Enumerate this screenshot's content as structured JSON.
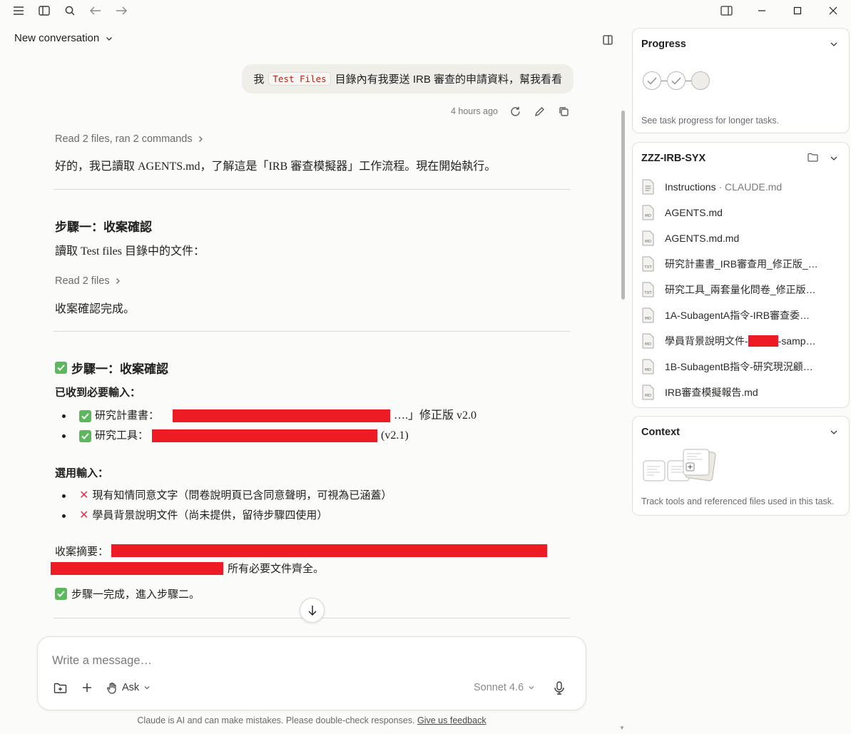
{
  "conversation": {
    "title": "New conversation"
  },
  "user_message": {
    "prefix": "我",
    "code": "Test Files",
    "suffix": "目錄內有我要送 IRB 審查的申請資料，幫我看看",
    "timestamp": "4 hours ago"
  },
  "assistant": {
    "tool1": "Read 2 files, ran 2 commands",
    "intro": "好的，我已讀取 AGENTS.md，了解這是「IRB 審查模擬器」工作流程。現在開始執行。",
    "step1_heading": "步驟一：收案確認",
    "step1_text": "讀取 Test files 目錄中的文件：",
    "tool2": "Read 2 files",
    "step1_done": "收案確認完成。",
    "step1b_heading": "步驟一：收案確認",
    "required_heading": "已收到必要輸入：",
    "required_items": [
      {
        "label": "研究計畫書：",
        "tail": "….」修正版 v2.0"
      },
      {
        "label": "研究工具：",
        "tail": "(v2.1)"
      }
    ],
    "optional_heading": "選用輸入：",
    "optional_items": [
      "現有知情同意文字（問卷說明頁已含同意聲明，可視為已涵蓋）",
      "學員背景說明文件（尚未提供，留待步驟四使用）"
    ],
    "summary_label": "收案摘要：",
    "summary_tail": "所有必要文件齊全。",
    "step1_complete": "步驟一完成，進入步驟二。"
  },
  "composer": {
    "placeholder": "Write a message…",
    "ask_label": "Ask",
    "model": "Sonnet 4.6"
  },
  "footer": {
    "disclaimer": "Claude is AI and can make mistakes. Please double-check responses.",
    "feedback_link": "Give us feedback"
  },
  "progress_panel": {
    "title": "Progress",
    "note": "See task progress for longer tasks."
  },
  "files_panel": {
    "title": "ZZZ-IRB-SYX",
    "files": [
      {
        "name": "Instructions",
        "dim": " · CLAUDE.md",
        "type": "DOC"
      },
      {
        "name": "AGENTS.md",
        "dim": "",
        "type": "MD"
      },
      {
        "name": "AGENTS.md.md",
        "dim": "",
        "type": "MD"
      },
      {
        "name": "研究計畫書_IRB審查用_修正版_…",
        "dim": "",
        "type": "TXT"
      },
      {
        "name": "研究工具_兩套量化問卷_修正版…",
        "dim": "",
        "type": "TXT"
      },
      {
        "name": "1A-SubagentA指令-IRB審查委…",
        "dim": "",
        "type": "MD"
      },
      {
        "name": "學員背景說明文件-",
        "dim": "",
        "type": "MD",
        "tail": "-samp…"
      },
      {
        "name": "1B-SubagentB指令-研究現況顧…",
        "dim": "",
        "type": "MD"
      },
      {
        "name": "IRB審查模擬報告.md",
        "dim": "",
        "type": "MD"
      }
    ]
  },
  "context_panel": {
    "title": "Context",
    "note": "Track tools and referenced files used in this task."
  },
  "colors": {
    "redaction": "#ed1c24",
    "check_green": "#5cb85c",
    "cross_red": "#e0344e",
    "code_red": "#b3261e"
  }
}
